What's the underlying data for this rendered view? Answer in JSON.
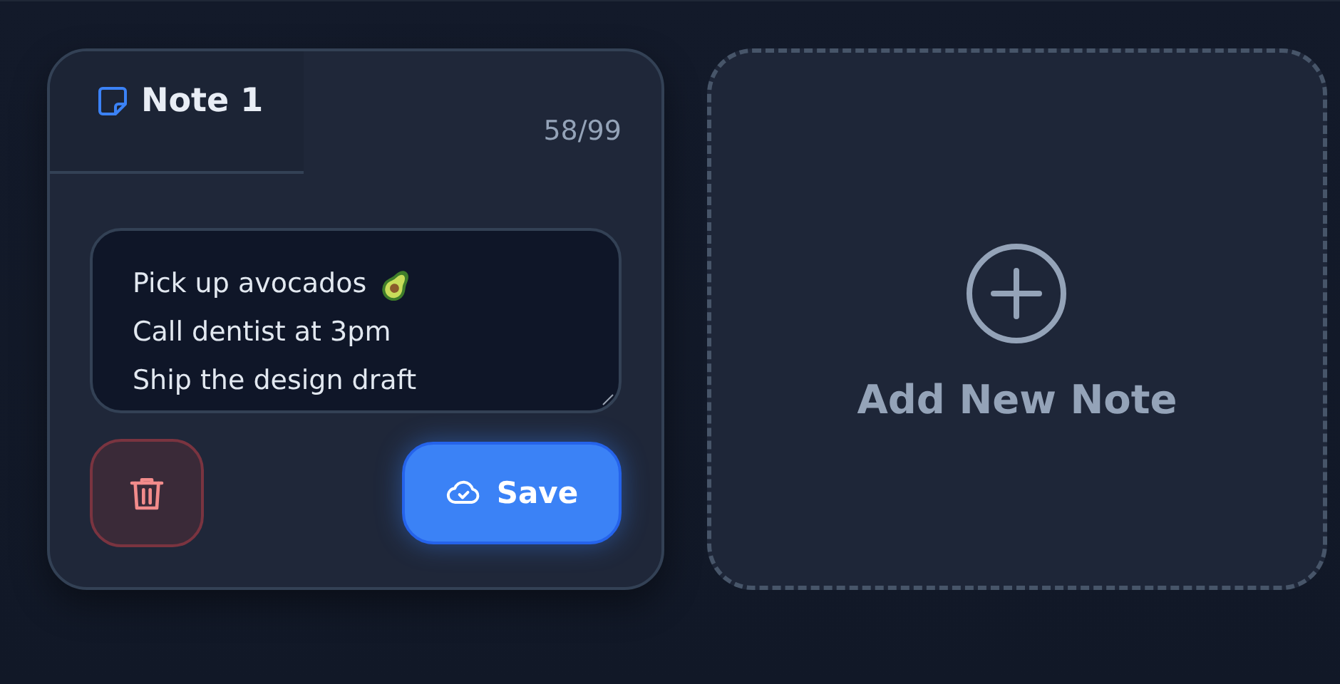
{
  "note": {
    "title": "Note 1",
    "counter": "58/99",
    "lines": [
      {
        "text": "Pick up avocados",
        "emoji": true
      },
      {
        "text": "Call dentist at 3pm",
        "emoji": false
      },
      {
        "text": "Ship the design draft",
        "emoji": false
      }
    ],
    "save_label": "Save"
  },
  "add_card": {
    "label": "Add New Note"
  }
}
